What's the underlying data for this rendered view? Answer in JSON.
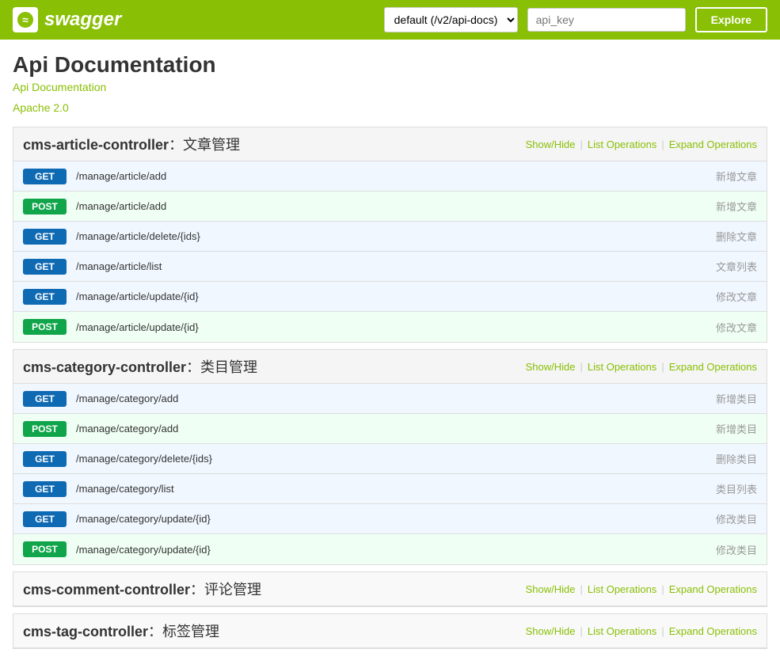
{
  "header": {
    "logo_text": "swagger",
    "logo_icon": "≈",
    "select_value": "default (/v2/api-docs)",
    "api_key_placeholder": "api_key",
    "explore_label": "Explore"
  },
  "page": {
    "title": "Api Documentation",
    "subtitle": "Api Documentation",
    "license": "Apache 2.0"
  },
  "controllers": [
    {
      "id": "cms-article-controller",
      "name": "cms-article-controller",
      "desc": "：文章管理",
      "actions": {
        "show_hide": "Show/Hide",
        "list_ops": "List Operations",
        "expand_ops": "Expand Operations"
      },
      "routes": [
        {
          "method": "GET",
          "path": "/manage/article/add",
          "desc": "新增文章"
        },
        {
          "method": "POST",
          "path": "/manage/article/add",
          "desc": "新增文章"
        },
        {
          "method": "GET",
          "path": "/manage/article/delete/{ids}",
          "desc": "删除文章"
        },
        {
          "method": "GET",
          "path": "/manage/article/list",
          "desc": "文章列表"
        },
        {
          "method": "GET",
          "path": "/manage/article/update/{id}",
          "desc": "修改文章"
        },
        {
          "method": "POST",
          "path": "/manage/article/update/{id}",
          "desc": "修改文章"
        }
      ]
    },
    {
      "id": "cms-category-controller",
      "name": "cms-category-controller",
      "desc": "：类目管理",
      "actions": {
        "show_hide": "Show/Hide",
        "list_ops": "List Operations",
        "expand_ops": "Expand Operations"
      },
      "routes": [
        {
          "method": "GET",
          "path": "/manage/category/add",
          "desc": "新增类目"
        },
        {
          "method": "POST",
          "path": "/manage/category/add",
          "desc": "新增类目"
        },
        {
          "method": "GET",
          "path": "/manage/category/delete/{ids}",
          "desc": "删除类目"
        },
        {
          "method": "GET",
          "path": "/manage/category/list",
          "desc": "类目列表"
        },
        {
          "method": "GET",
          "path": "/manage/category/update/{id}",
          "desc": "修改类目"
        },
        {
          "method": "POST",
          "path": "/manage/category/update/{id}",
          "desc": "修改类目"
        }
      ]
    },
    {
      "id": "cms-comment-controller",
      "name": "cms-comment-controller",
      "desc": "：评论管理",
      "actions": {
        "show_hide": "Show/Hide",
        "list_ops": "List Operations",
        "expand_ops": "Expand Operations"
      },
      "routes": []
    },
    {
      "id": "cms-tag-controller",
      "name": "cms-tag-controller",
      "desc": "：标签管理",
      "actions": {
        "show_hide": "Show/Hide",
        "list_ops": "List Operations",
        "expand_ops": "Expand Operations"
      },
      "routes": []
    }
  ]
}
